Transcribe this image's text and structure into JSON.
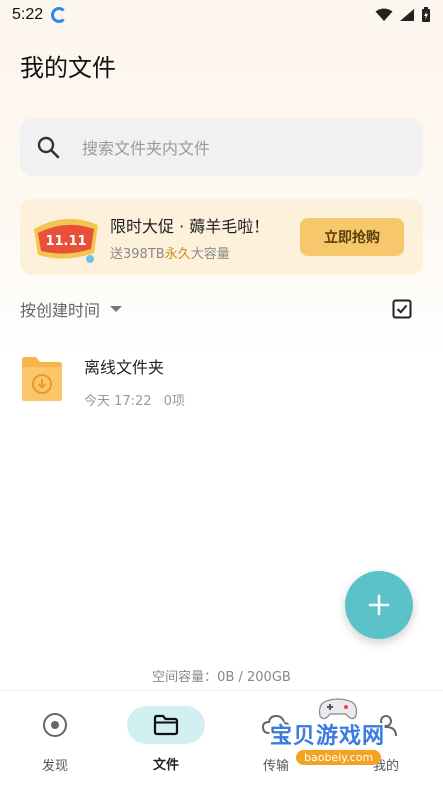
{
  "status_bar": {
    "time": "5:22"
  },
  "header": {
    "title": "我的文件"
  },
  "search": {
    "placeholder": "搜索文件夹内文件"
  },
  "promo": {
    "title": "限时大促 · 薅羊毛啦！",
    "subtitle_prefix": "送398TB",
    "subtitle_highlight": "永久",
    "subtitle_suffix": "大容量",
    "button_label": "立即抢购",
    "badge_text": "11.11"
  },
  "sort": {
    "label": "按创建时间"
  },
  "files": [
    {
      "name": "离线文件夹",
      "date": "今天 17:22",
      "count": "0项",
      "icon": "offline-folder-icon"
    }
  ],
  "storage": {
    "text": "空间容量：0B / 200GB"
  },
  "bottom_nav": {
    "items": [
      {
        "label": "发现",
        "icon": "discover-icon"
      },
      {
        "label": "文件",
        "icon": "folder-icon",
        "active": true
      },
      {
        "label": "传输",
        "icon": "cloud-transfer-icon"
      },
      {
        "label": "我的",
        "icon": "profile-icon"
      }
    ]
  },
  "watermark": {
    "text": "宝贝游戏网",
    "url": "baobeiy.com"
  },
  "colors": {
    "accent": "#5bc2c9",
    "promo_bg": "#fdf1dc",
    "promo_button": "#f6c86b",
    "folder": "#f7b54a"
  }
}
